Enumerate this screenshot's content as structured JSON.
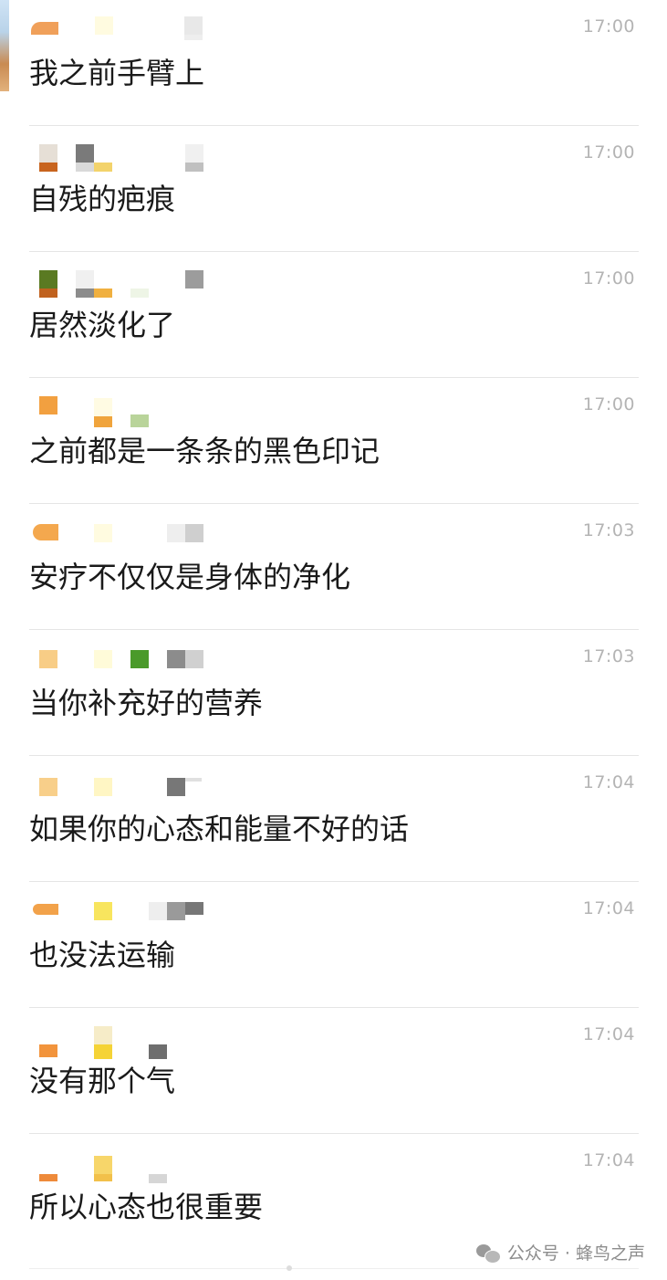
{
  "messages": [
    {
      "time": "17:00",
      "text": "我之前手臂上"
    },
    {
      "time": "17:00",
      "text": "自残的疤痕"
    },
    {
      "time": "17:00",
      "text": "居然淡化了"
    },
    {
      "time": "17:00",
      "text": "之前都是一条条的黑色印记"
    },
    {
      "time": "17:03",
      "text": "安疗不仅仅是身体的净化"
    },
    {
      "time": "17:03",
      "text": "当你补充好的营养"
    },
    {
      "time": "17:04",
      "text": "如果你的心态和能量不好的话"
    },
    {
      "time": "17:04",
      "text": "也没法运输"
    },
    {
      "time": "17:04",
      "text": "没有那个气"
    },
    {
      "time": "17:04",
      "text": "所以心态也很重要"
    }
  ],
  "watermark": {
    "icon": "wechat-icon",
    "text": "公众号 · 蜂鸟之声"
  },
  "colors": {
    "time": "#b4b4b4",
    "message_text": "#1a1a1a",
    "divider": "#e5e5e5",
    "watermark": "#8c8c8c"
  }
}
